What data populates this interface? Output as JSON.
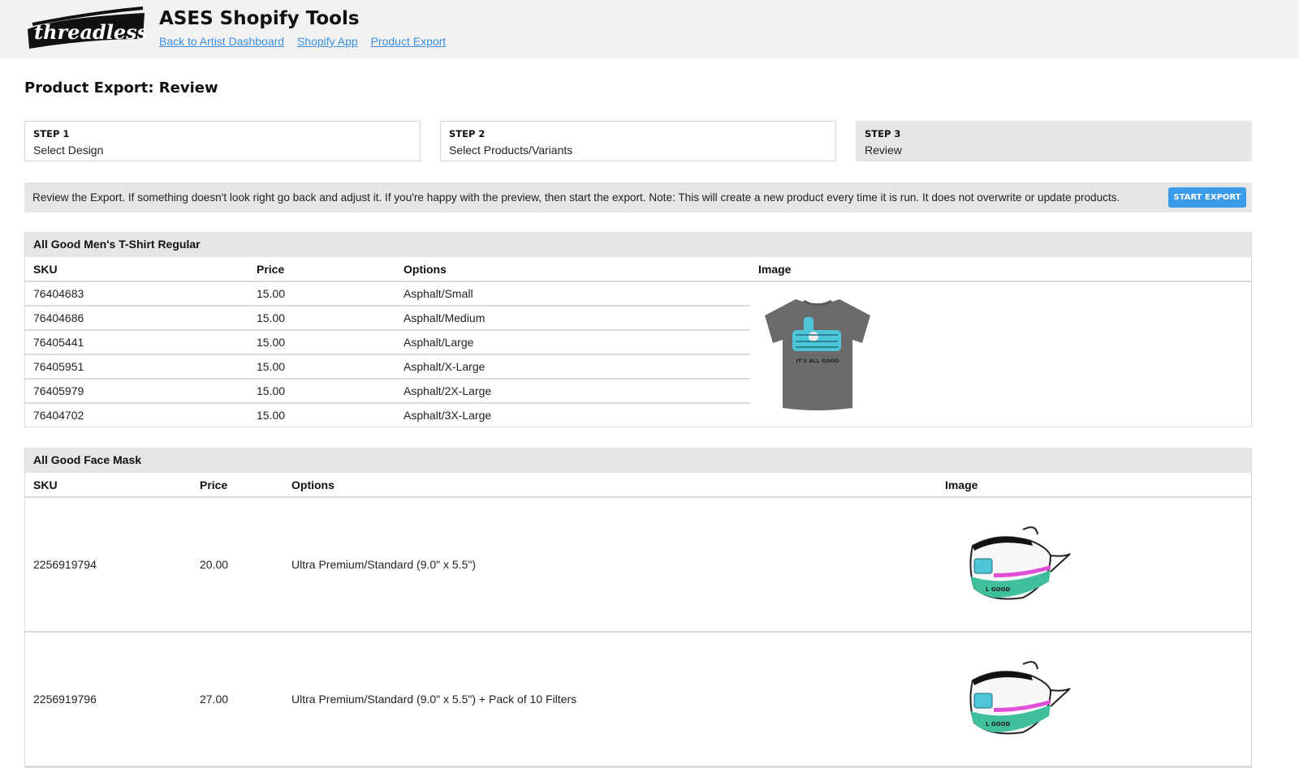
{
  "header": {
    "logo_text": "threadless",
    "app_title": "ASES Shopify Tools",
    "nav": [
      {
        "label": "Back to Artist Dashboard"
      },
      {
        "label": "Shopify App"
      },
      {
        "label": "Product Export"
      }
    ]
  },
  "page": {
    "title": "Product Export: Review"
  },
  "steps": [
    {
      "key": "STEP 1",
      "label": "Select Design",
      "active": false
    },
    {
      "key": "STEP 2",
      "label": "Select Products/Variants",
      "active": false
    },
    {
      "key": "STEP 3",
      "label": "Review",
      "active": true
    }
  ],
  "notice": {
    "text": "Review the Export. If something doesn't look right go back and adjust it. If you're happy with the preview, then start the export. Note: This will create a new product every time it is run. It does not overwrite or update products.",
    "button_label": "START EXPORT"
  },
  "products": [
    {
      "title": "All Good Men's T-Shirt Regular",
      "columns": [
        "SKU",
        "Price",
        "Options",
        "Image"
      ],
      "image_icon": "tshirt-thumbs-up-image",
      "rows": [
        {
          "sku": "76404683",
          "price": "15.00",
          "options": "Asphalt/Small"
        },
        {
          "sku": "76404686",
          "price": "15.00",
          "options": "Asphalt/Medium"
        },
        {
          "sku": "76405441",
          "price": "15.00",
          "options": "Asphalt/Large"
        },
        {
          "sku": "76405951",
          "price": "15.00",
          "options": "Asphalt/X-Large"
        },
        {
          "sku": "76405979",
          "price": "15.00",
          "options": "Asphalt/2X-Large"
        },
        {
          "sku": "76404702",
          "price": "15.00",
          "options": "Asphalt/3X-Large"
        }
      ],
      "image_caption": "IT'S ALL GOOD"
    },
    {
      "title": "All Good Face Mask",
      "columns": [
        "SKU",
        "Price",
        "Options",
        "Image"
      ],
      "image_icon": "face-mask-image",
      "rows": [
        {
          "sku": "2256919794",
          "price": "20.00",
          "options": "Ultra Premium/Standard (9.0\" x 5.5\")"
        },
        {
          "sku": "2256919796",
          "price": "27.00",
          "options": "Ultra Premium/Standard (9.0\" x 5.5\") + Pack of 10 Filters"
        }
      ],
      "image_caption": "L GOOD"
    }
  ],
  "colors": {
    "link": "#3a8edd",
    "button": "#3a9bea",
    "panel": "#e6e6e6",
    "shirt": "#6b6b6b",
    "design": "#4fc6d8",
    "mask_teal": "#3fbf9c",
    "mask_pink": "#e04fd6"
  }
}
